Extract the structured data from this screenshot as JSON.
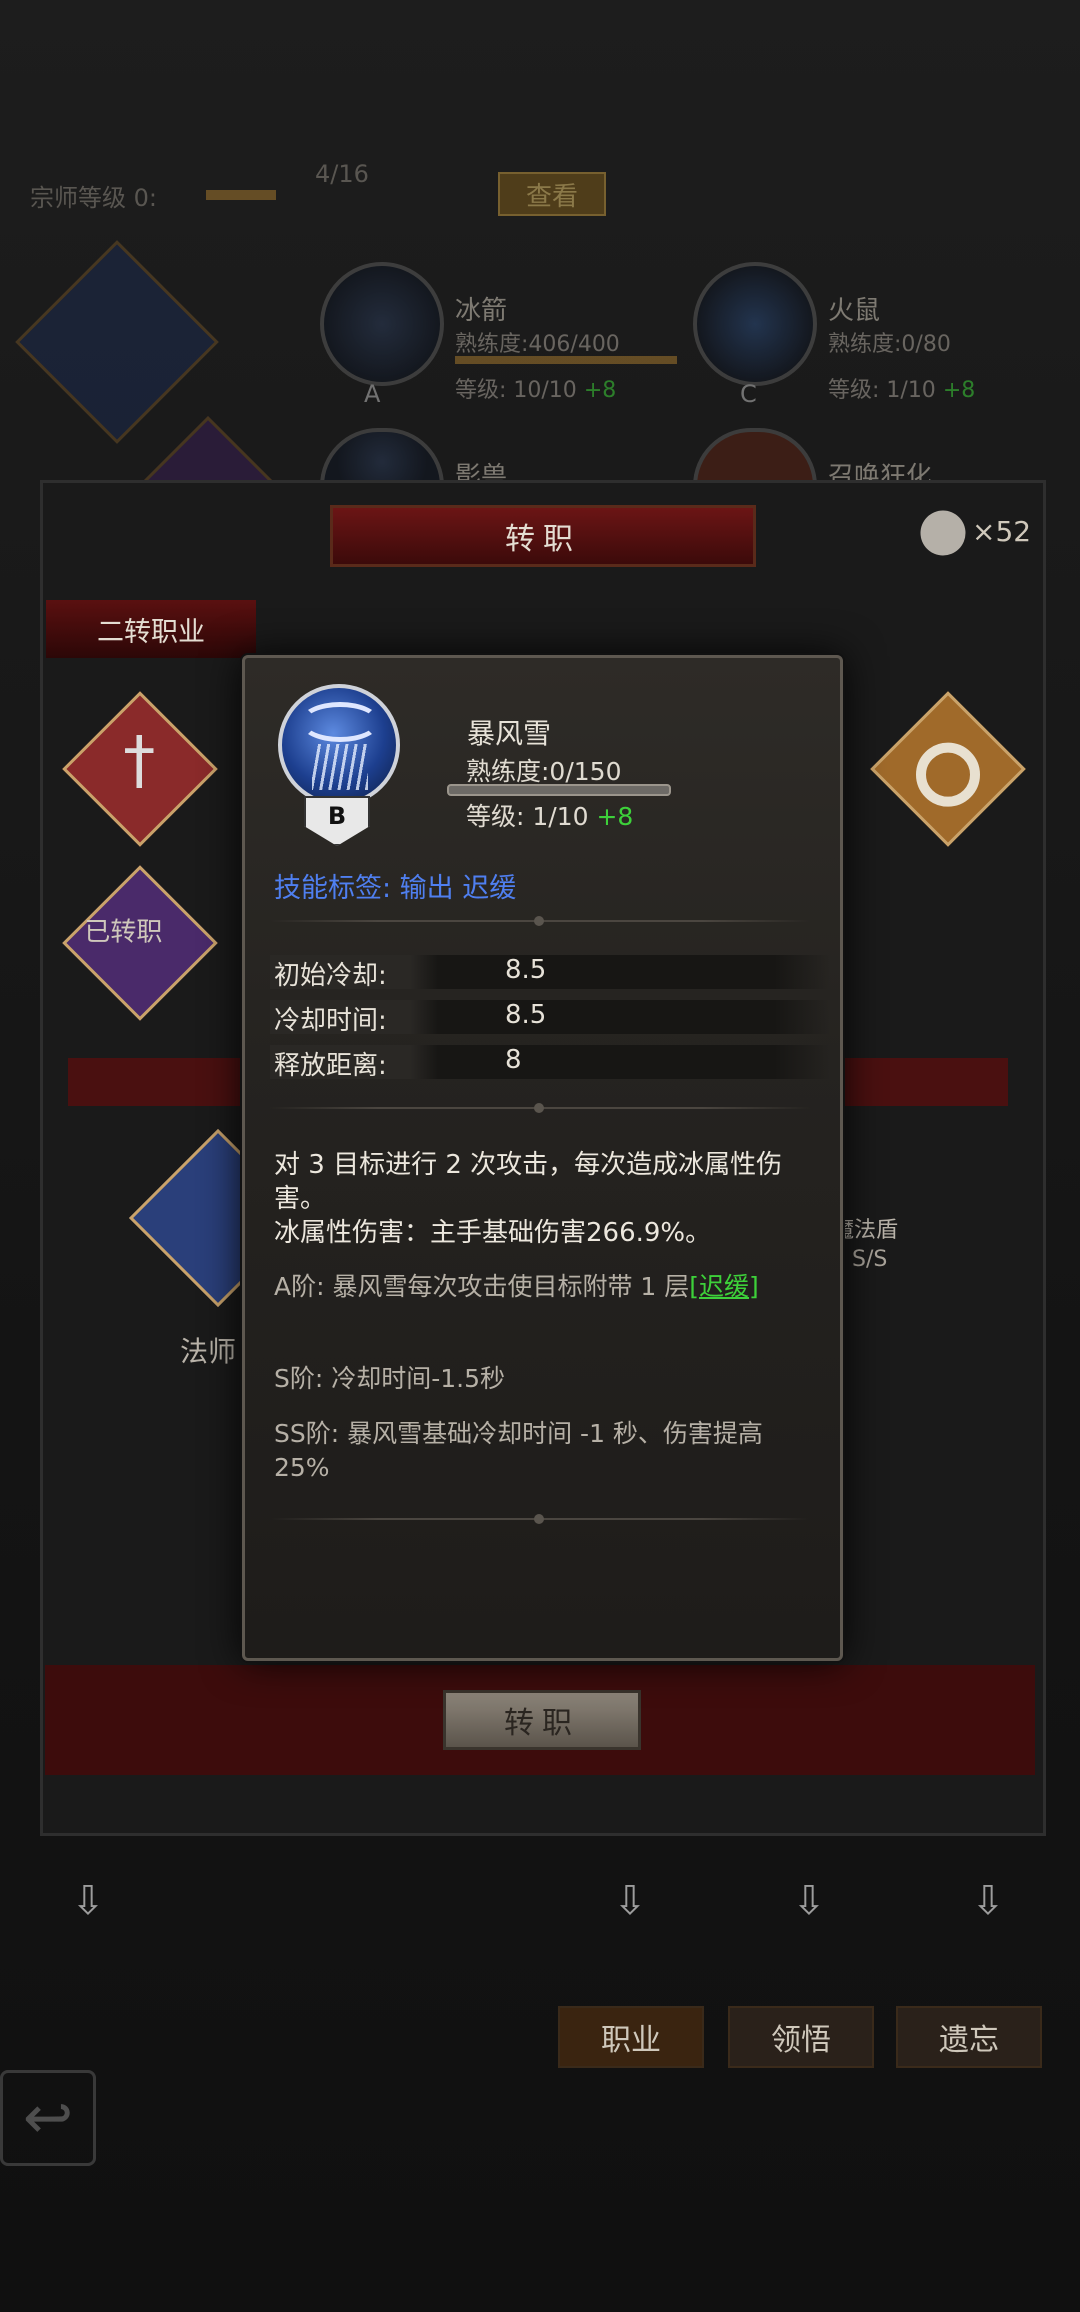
{
  "background": {
    "master_level_label": "宗师等级 0:",
    "master_progress": "4/16",
    "view_button": "查看",
    "skills": [
      {
        "name": "冰箭",
        "proficiency": "熟练度:406/400",
        "level": "等级: 10/10",
        "plus": "+8",
        "grade": "A"
      },
      {
        "name": "火鼠",
        "proficiency": "熟练度:0/80",
        "level": "等级: 1/10",
        "plus": "+8",
        "grade": "C"
      },
      {
        "name": "影兽",
        "proficiency": "",
        "level": "",
        "plus": "",
        "grade": ""
      },
      {
        "name": "召唤狂化",
        "proficiency": "",
        "level": "",
        "plus": "",
        "grade": ""
      }
    ]
  },
  "dialog": {
    "title": "转职",
    "item_count": "×52",
    "section_tab": "二转职业",
    "transferred_label": "已转职",
    "class_name": "法师",
    "side_skill_name": "魔法盾",
    "side_skill_grade": "S/S",
    "confirm_button": "转职"
  },
  "bottom_nav": {
    "tabs": [
      "职业",
      "领悟",
      "遗忘"
    ]
  },
  "popup": {
    "skill_name": "暴风雪",
    "grade": "B",
    "proficiency": "熟练度:0/150",
    "proficiency_fraction": 0,
    "level": "等级: 1/10",
    "level_plus": "+8",
    "tags": "技能标签:  输出  迟缓",
    "stats": [
      {
        "label": "初始冷却:",
        "value": "8.5"
      },
      {
        "label": "冷却时间:",
        "value": "8.5"
      },
      {
        "label": "释放距离:",
        "value": "8"
      }
    ],
    "description": "对 3 目标进行 2 次攻击，每次造成冰属性伤害。",
    "damage": "冰属性伤害：主手基础伤害266.9%。",
    "tier_a_prefix": "A阶: 暴风雪每次攻击使目标附带 1 层",
    "tier_a_link": "[迟缓]",
    "tier_s": "S阶: 冷却时间-1.5秒",
    "tier_ss": "SS阶: 暴风雪基础冷却时间 -1 秒、伤害提高 25%"
  },
  "colors": {
    "accent_green": "#3dd13a",
    "tag_blue": "#4f7ff0",
    "header_red": "#6b1515"
  }
}
